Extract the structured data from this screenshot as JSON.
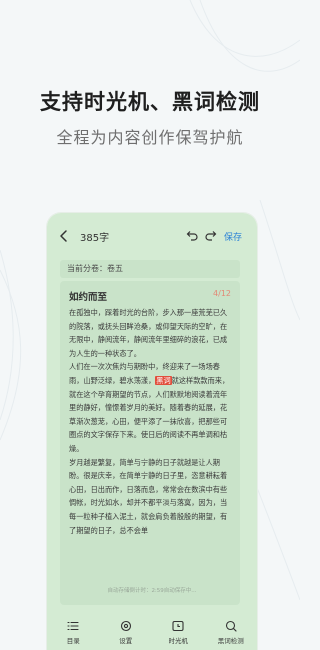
{
  "promo": {
    "headline": "支持时光机、黑词检测",
    "subheadline": "全程为内容创作保驾护航"
  },
  "editor": {
    "word_count": "385字",
    "save_label": "保存",
    "volume_label": "当前分卷：卷五",
    "chapter_title": "如约而至",
    "page_indicator": "4/12",
    "paragraphs": [
      "在孤独中，踩着时光的台阶，步入那一座荒芜已久的院落，或抚头回眸沧桑，或仰望天际的空旷，在无限中，静阅流年，静阅流年里细碎的浪花，已成为人生的一种状态了。",
      "人们在一次次焦灼与期盼中，终迎来了一场场春雨，山野泛绿，碧水荡漾，",
      "就这样款款而来，就在这个孕育期望的节点，人们默默地阅读着流年里的静好，憧憬着岁月的美好。随着春的延展，花草渐次葱茏，心田，便平添了一抹欣喜，把那些可圈点的文字保存下来。使日后的阅读不再单调和枯燥。",
      "岁月越是繁复，简单与宁静的日子就越是让人期盼。很是庆幸，在简单宁静的日子里，恣意耕耘着心田，日出而作，日落而息，常常会在数滨中有些惆帐，时光如水，却并不都平淡与落寞，因为，当每一粒种子植入泥土，就会肩负着殷殷的期望，有了期望的日子，总不会单"
    ],
    "highlighted_word": "黑词",
    "autosave_text": "自动存储倒计时：2:59自动保存中..."
  },
  "tabbar": {
    "items": [
      {
        "label": "目录",
        "icon": "list-icon"
      },
      {
        "label": "设置",
        "icon": "gear-icon"
      },
      {
        "label": "时光机",
        "icon": "time-machine-icon"
      },
      {
        "label": "黑词检测",
        "icon": "search-icon"
      }
    ]
  },
  "colors": {
    "accent": "#2c83d6",
    "highlight": "#e14e3c",
    "paper": "#c9e3c9",
    "screen_bg": "#d4ebd3"
  }
}
